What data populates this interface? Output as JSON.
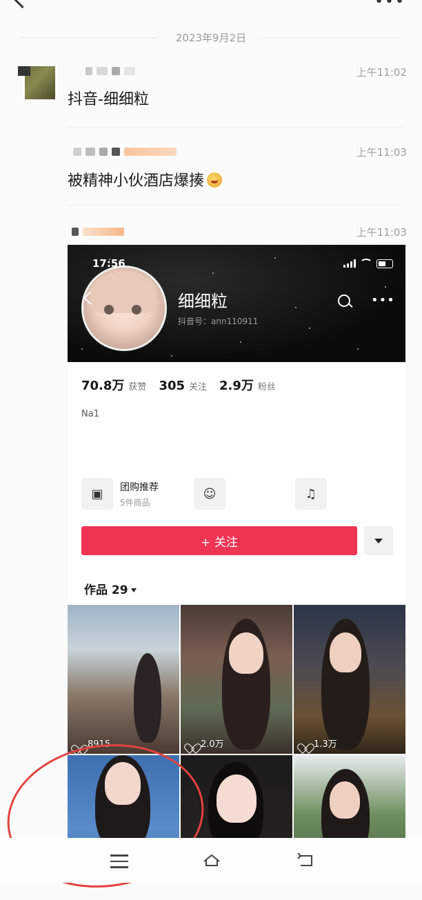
{
  "chat": {
    "date": "2023年9月2日",
    "messages": [
      {
        "time": "上午11:02",
        "text": "抖音-细细粒"
      },
      {
        "time": "上午11:03",
        "text": "被精神小伙酒店爆揍"
      },
      {
        "time": "上午11:03",
        "text": ""
      }
    ]
  },
  "profile": {
    "status_time": "17:56",
    "name": "细细粒",
    "douyin_id": "抖音号：ann110911",
    "stats": [
      {
        "value": "70.8万",
        "label": "获赞"
      },
      {
        "value": "305",
        "label": "关注"
      },
      {
        "value": "2.9万",
        "label": "粉丝"
      }
    ],
    "bio": "Na1",
    "services": [
      {
        "icon": "shop-bag-icon",
        "title": "团购推荐",
        "sub": "5件商品"
      },
      {
        "icon": "user-group-icon"
      },
      {
        "icon": "music-note-icon"
      }
    ],
    "follow_label": "+ 关注",
    "works_tab": "作品 29",
    "videos": [
      {
        "likes": "8915"
      },
      {
        "likes": "2.0万"
      },
      {
        "likes": "1.3万"
      },
      {
        "likes": ""
      },
      {
        "likes": ""
      },
      {
        "likes": ""
      }
    ]
  },
  "colors": {
    "accent": "#ef3454",
    "annotation_circle": "#e3423f"
  }
}
